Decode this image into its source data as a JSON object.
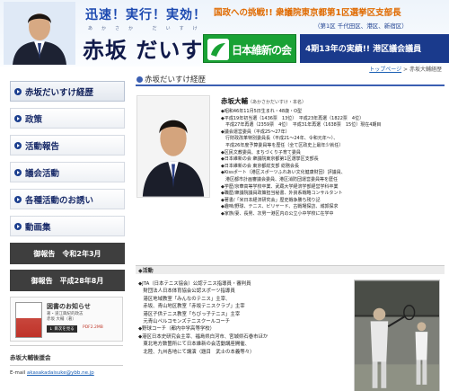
{
  "header": {
    "slogan": "迅速！実行！実効！",
    "name_ruby": "あかさか だいすけ",
    "name": "赤坂 だいすけ",
    "challenge": "国政への挑戦!! 衆議院東京都第1区選挙区支部長",
    "challenge_sub": "（第1区 千代田区、港区、新宿区）",
    "party": "日本維新の会",
    "result": "4期13年の実績!! 港区議会議員"
  },
  "breadcrumb": {
    "home": "トップページ",
    "separator": " > ",
    "current": "赤坂大輔経歴"
  },
  "sidebar": {
    "nav": [
      {
        "label": "赤坂だいすけ経歴"
      },
      {
        "label": "政策"
      },
      {
        "label": "活動報告"
      },
      {
        "label": "議会活動"
      },
      {
        "label": "各種活動のお誘い"
      },
      {
        "label": "動画集"
      }
    ],
    "reports": [
      "御報告　令和2年3月",
      "御報告　平成28年8月"
    ],
    "book": {
      "title": "図書のお知らせ",
      "desc_line1": "著・道江興紀的政志",
      "desc_line2": "赤坂 大輔（著）",
      "download": "↓ 目次を見る",
      "pdf": "PDF2.2MB"
    },
    "office": "赤坂大輔後援会",
    "email_label": "E-mail",
    "email": "akasakadaisuke@ybb.ne.jp"
  },
  "main": {
    "section_title": "赤坂だいすけ経歴",
    "profile_name": "赤坂大輔",
    "profile_ruby": "（あかさかだいすけ・本名）",
    "profile_items": [
      "◆昭和46年11月5日生まれ・48歳・O型",
      "◆平成19年初当選（1436票　13位）　平成23年再選（1822票　4位）",
      "　平成27年再選（2359票　4位）　平成31年再選（1638票　15位）現在4期目",
      "◆議会運営委員（平成25〜27年）",
      "　行財政改革特別委員長（平成21〜24年、令和元年〜）、",
      "　平成26年度予算委員等を歴任（全て区政史上最年少就任）",
      "◆区民文教委員、まちづくり子育て委員",
      "◆日本維新の会 衆議院東京都第1区選挙区支部長",
      "◆日本維新の会 東京都総支部 総務会長",
      "◆Kissポート（港区スポーツふれあい文化健康財団）評議員、",
      "　港区都市計画審議会委員、港区消防団運営委員等を歴任",
      "◆学歴/京華高等学校卒業、武蔵大学経済学部経営学科卒業",
      "◆職歴/衆議院議員政策担当秘書、外資系戦略コンサルタント",
      "◆著書/「米日本経済研究会」歴史戦争勝ち残り記",
      "◆趣味/野球、テニス、ビリヤード、古戦場探訪、城郭探求",
      "◆家族/妻、長男、次男一港区内の公立小中学校に在学中"
    ],
    "activity_title": "◆活動",
    "activities": [
      "◆JTA（日本テニス協会）公認テニス指導員・審判員",
      "　財団法人日本体育協会公認スポーツ指導員",
      "　港区地域教室「みんなのテニス」主宰、",
      "　赤坂、青山地区教室「赤坂テニスクラブ」主宰",
      "　港区子供テニス教室「ちびっ子テニス」主宰",
      "　元青山ペルコモンズテニスクールコーチ",
      "◆野球コーチ（都内中学高等学校）",
      "◆港区日本史研究会主宰、福島県白河市、宮城県石巻市ほか",
      "　東北地方数箇所にて日本維新の会活動講座開催、",
      "　北陸、九州各地にて講演（題目　武士の本義等々）"
    ]
  }
}
